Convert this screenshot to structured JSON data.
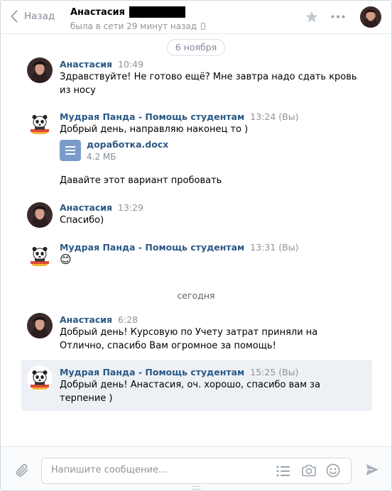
{
  "header": {
    "back_label": "Назад",
    "peer_name": "Анастасия",
    "peer_status": "была в сети 29 минут назад"
  },
  "composer": {
    "placeholder": "Напишите сообщение..."
  },
  "dates": {
    "first": "6 ноября",
    "today": "сегодня"
  },
  "messages": [
    {
      "author": "Анастасия",
      "time": "10:49",
      "text": "Здравствуйте! Не готово ещё? Мне завтра надо сдать кровь из носу"
    },
    {
      "author": "Мудрая Панда - Помощь студентам",
      "time": "13:24 (Вы)",
      "text": "Добрый день, направляю наконец то )",
      "attachment": {
        "name": "доработка.docx",
        "size": "4.2 МБ"
      },
      "text2": "Давайте этот вариант пробовать"
    },
    {
      "author": "Анастасия",
      "time": "13:29",
      "text": "Спасибо)"
    },
    {
      "author": "Мудрая Панда - Помощь студентам",
      "time": "13:31 (Вы)",
      "emoji": "😊"
    },
    {
      "author": "Анастасия",
      "time": "6:28",
      "text": "Добрый день! Курсовую по Учету затрат приняли на Отлично, спасибо Вам огромное за помощь!"
    },
    {
      "author": "Мудрая Панда - Помощь студентам",
      "time": "15:25 (Вы)",
      "text": "Добрый день! Анастасия, оч. хорошо, спасибо вам за терпение )"
    }
  ]
}
